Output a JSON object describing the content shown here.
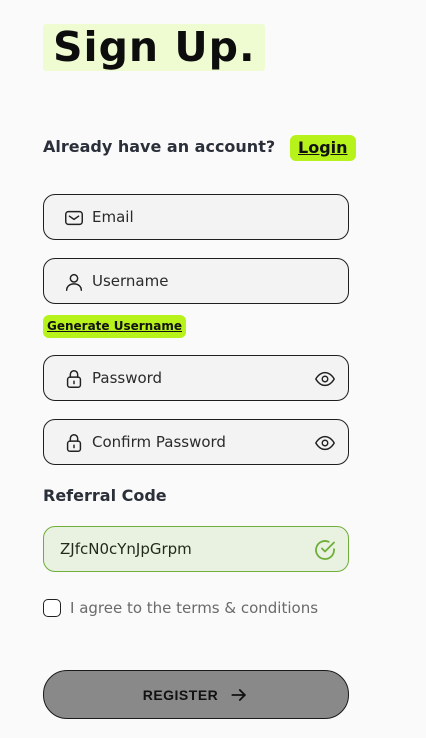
{
  "title": "Sign Up.",
  "login_prompt": {
    "text": "Already have an account?",
    "link": "Login"
  },
  "fields": {
    "email": {
      "placeholder": "Email",
      "value": "",
      "icon": "mail-icon"
    },
    "username": {
      "placeholder": "Username",
      "value": "",
      "icon": "user-icon"
    },
    "password": {
      "placeholder": "Password",
      "value": "",
      "icon": "lock-icon"
    },
    "confirm_password": {
      "placeholder": "Confirm Password",
      "value": "",
      "icon": "lock-icon"
    }
  },
  "generate_username": "Generate Username",
  "referral": {
    "label": "Referral Code",
    "value": "ZJfcN0cYnJpGrpm",
    "status_icon": "check-circle-icon"
  },
  "terms": {
    "text": "I agree to the terms & conditions",
    "checked": false
  },
  "register_button": {
    "label": "REGISTER",
    "icon": "arrow-right-icon"
  },
  "colors": {
    "accent": "#b7f21a",
    "title_highlight": "#effbd0",
    "valid_border": "#6fae3a",
    "valid_bg": "#e9f1e0",
    "register_bg": "#898989"
  }
}
